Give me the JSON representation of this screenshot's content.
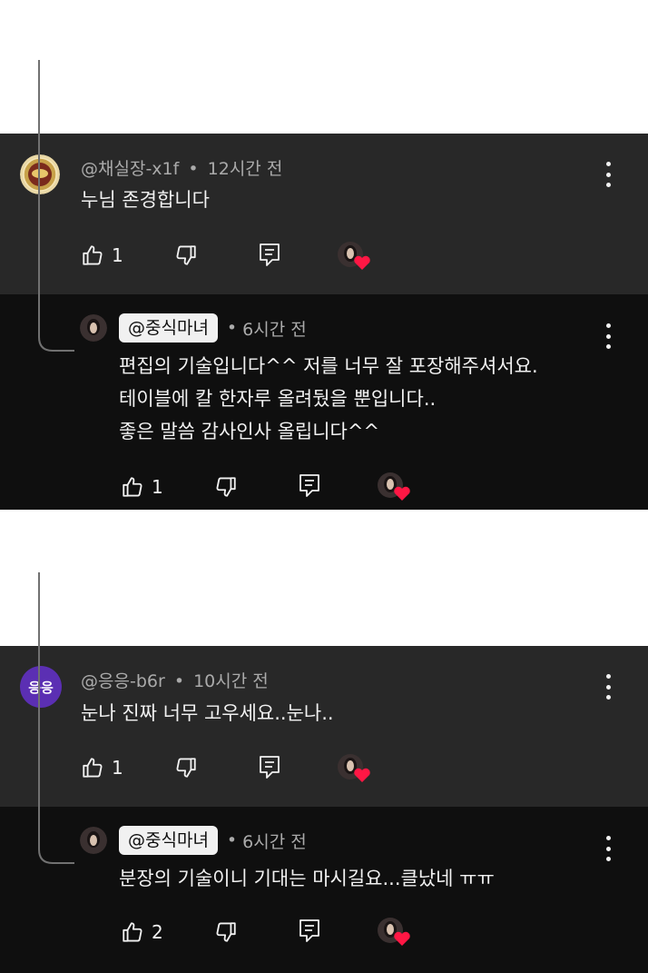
{
  "threads": [
    {
      "parent": {
        "handle": "@채실장-x1f",
        "dot": "•",
        "time": "12시간 전",
        "text": "누님 존경합니다",
        "likes": "1",
        "avatar_icon": "gold-coin-avatar-icon"
      },
      "reply": {
        "mention": "@중식마녀",
        "dot": "•",
        "time": "6시간 전",
        "lines": [
          "편집의 기술입니다^^ 저를 너무 잘 포장해주셔서요.",
          "테이블에 칼 한자루 올려뒀을 뿐입니다..",
          "좋은 말씀 감사인사 올립니다^^"
        ],
        "likes": "1"
      }
    },
    {
      "parent": {
        "handle": "@응응-b6r",
        "dot": "•",
        "time": "10시간 전",
        "text": "눈나 진짜 너무 고우세요..눈나..",
        "likes": "1",
        "avatar_text": "응응"
      },
      "reply": {
        "mention": "@중식마녀",
        "dot": "•",
        "time": "6시간 전",
        "lines": [
          "분장의 기술이니 기대는 마시길요...클났네 ㅠㅠ"
        ],
        "likes": "2"
      }
    }
  ],
  "colors": {
    "parent_bg": "#282828",
    "reply_bg": "#0f0f0f",
    "meta_text": "#aaaaaa",
    "body_text": "#f1f1f1",
    "heart": "#ff1744",
    "avatar_purple": "#5b2fb3"
  }
}
